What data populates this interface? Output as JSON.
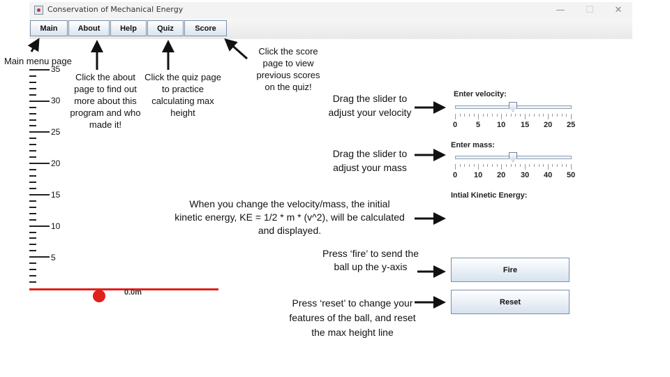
{
  "window": {
    "title": "Conservation of Mechanical Energy",
    "minimize": "—",
    "maximize": "☐",
    "close": "✕"
  },
  "menu": [
    "Main",
    "About",
    "Help",
    "Quiz",
    "Score"
  ],
  "ruler": {
    "labels": [
      "35",
      "30",
      "25",
      "20",
      "15",
      "10",
      "5"
    ]
  },
  "simulation": {
    "height_readout": "0.0m"
  },
  "controls": {
    "velocity_label": "Enter velocity:",
    "velocity_ticks": [
      "0",
      "5",
      "10",
      "15",
      "20",
      "25"
    ],
    "velocity_value": 12.5,
    "mass_label": "Enter mass:",
    "mass_ticks": [
      "0",
      "10",
      "20",
      "30",
      "40",
      "50"
    ],
    "mass_value": 25,
    "ke_label": "Intial Kinetic Energy:",
    "fire_label": "Fire",
    "reset_label": "Reset"
  },
  "annotations": {
    "main": "Main menu page",
    "about": "Click the about page to find out more about this program and who made it!",
    "quiz": "Click the quiz page to practice calculating max height",
    "score": "Click the score page to view previous scores on the quiz!",
    "velocity": "Drag the slider to adjust your velocity",
    "mass": "Drag the slider to adjust your mass",
    "ke": "When you change the velocity/mass, the initial kinetic energy, KE  = 1/2 * m * (v^2), will be calculated and displayed.",
    "fire": "Press ‘fire’ to send the ball up the y-axis",
    "reset": "Press ‘reset’ to change your features of the ball, and reset the max height line"
  }
}
